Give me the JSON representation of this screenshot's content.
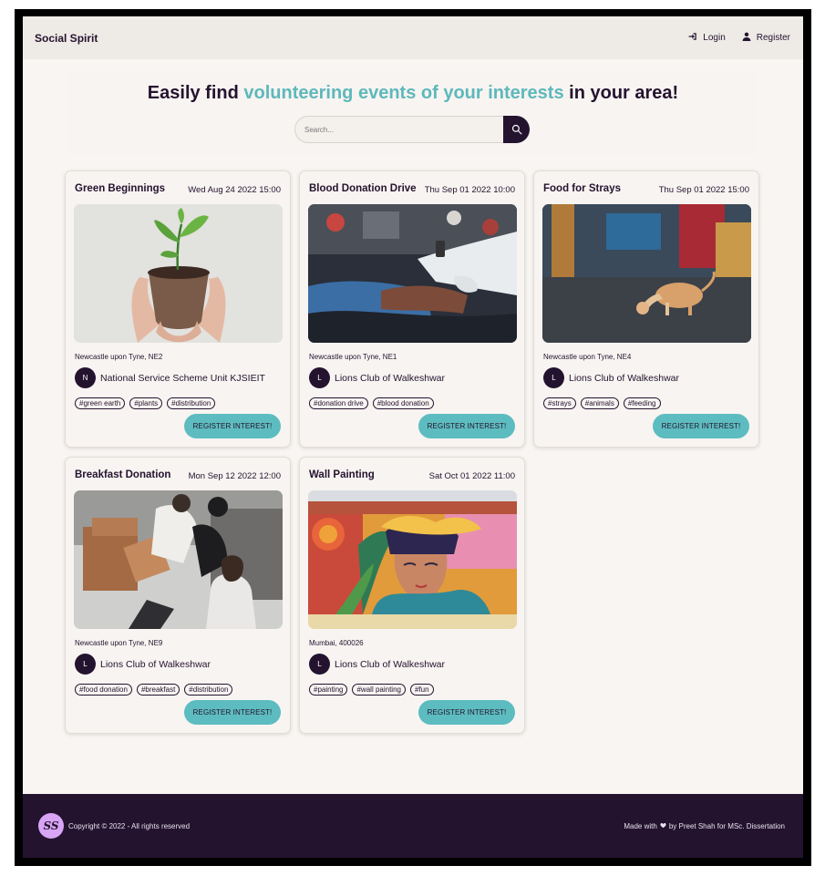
{
  "header": {
    "brand": "Social Spirit",
    "login_label": "Login",
    "register_label": "Register"
  },
  "hero": {
    "headline_pre": "Easily find ",
    "headline_accent": "volunteering events of your interests",
    "headline_post": " in your area!",
    "search_placeholder": "Search..."
  },
  "cards": [
    {
      "title": "Green Beginnings",
      "date": "Wed Aug 24 2022 15:00",
      "location": "Newcastle upon Tyne, NE2",
      "avatar": "N",
      "org": "National Service Scheme Unit KJSIEIT",
      "tags": [
        "#green earth",
        "#plants",
        "#distribution"
      ],
      "button": "REGISTER INTEREST!",
      "image": "plant-in-hands"
    },
    {
      "title": "Blood Donation Drive",
      "date": "Thu Sep 01 2022 10:00",
      "location": "Newcastle upon Tyne, NE1",
      "avatar": "L",
      "org": "Lions Club of Walkeshwar",
      "tags": [
        "#donation drive",
        "#blood donation"
      ],
      "button": "REGISTER INTEREST!",
      "image": "blood-donation"
    },
    {
      "title": "Food for Strays",
      "date": "Thu Sep 01 2022 15:00",
      "location": "Newcastle upon Tyne, NE4",
      "avatar": "L",
      "org": "Lions Club of Walkeshwar",
      "tags": [
        "#strays",
        "#animals",
        "#feeding"
      ],
      "button": "REGISTER INTEREST!",
      "image": "stray-cat"
    },
    {
      "title": "Breakfast Donation",
      "date": "Mon Sep 12 2022 12:00",
      "location": "Newcastle upon Tyne, NE9",
      "avatar": "L",
      "org": "Lions Club of Walkeshwar",
      "tags": [
        "#food donation",
        "#breakfast",
        "#distribution"
      ],
      "button": "REGISTER INTEREST!",
      "image": "food-boxes"
    },
    {
      "title": "Wall Painting",
      "date": "Sat Oct 01 2022 11:00",
      "location": "Mumbai, 400026",
      "avatar": "L",
      "org": "Lions Club of Walkeshwar",
      "tags": [
        "#painting",
        "#wall painting",
        "#fun"
      ],
      "button": "REGISTER INTEREST!",
      "image": "wall-mural"
    }
  ],
  "footer": {
    "logo": "SS",
    "copyright": "Copyright © 2022 - All rights reserved",
    "made_pre": "Made with",
    "made_post": "by Preet Shah for MSc. Dissertation"
  },
  "colors": {
    "primary": "#24132f",
    "accent": "#5eb8bb",
    "background": "#f8f5f2"
  }
}
